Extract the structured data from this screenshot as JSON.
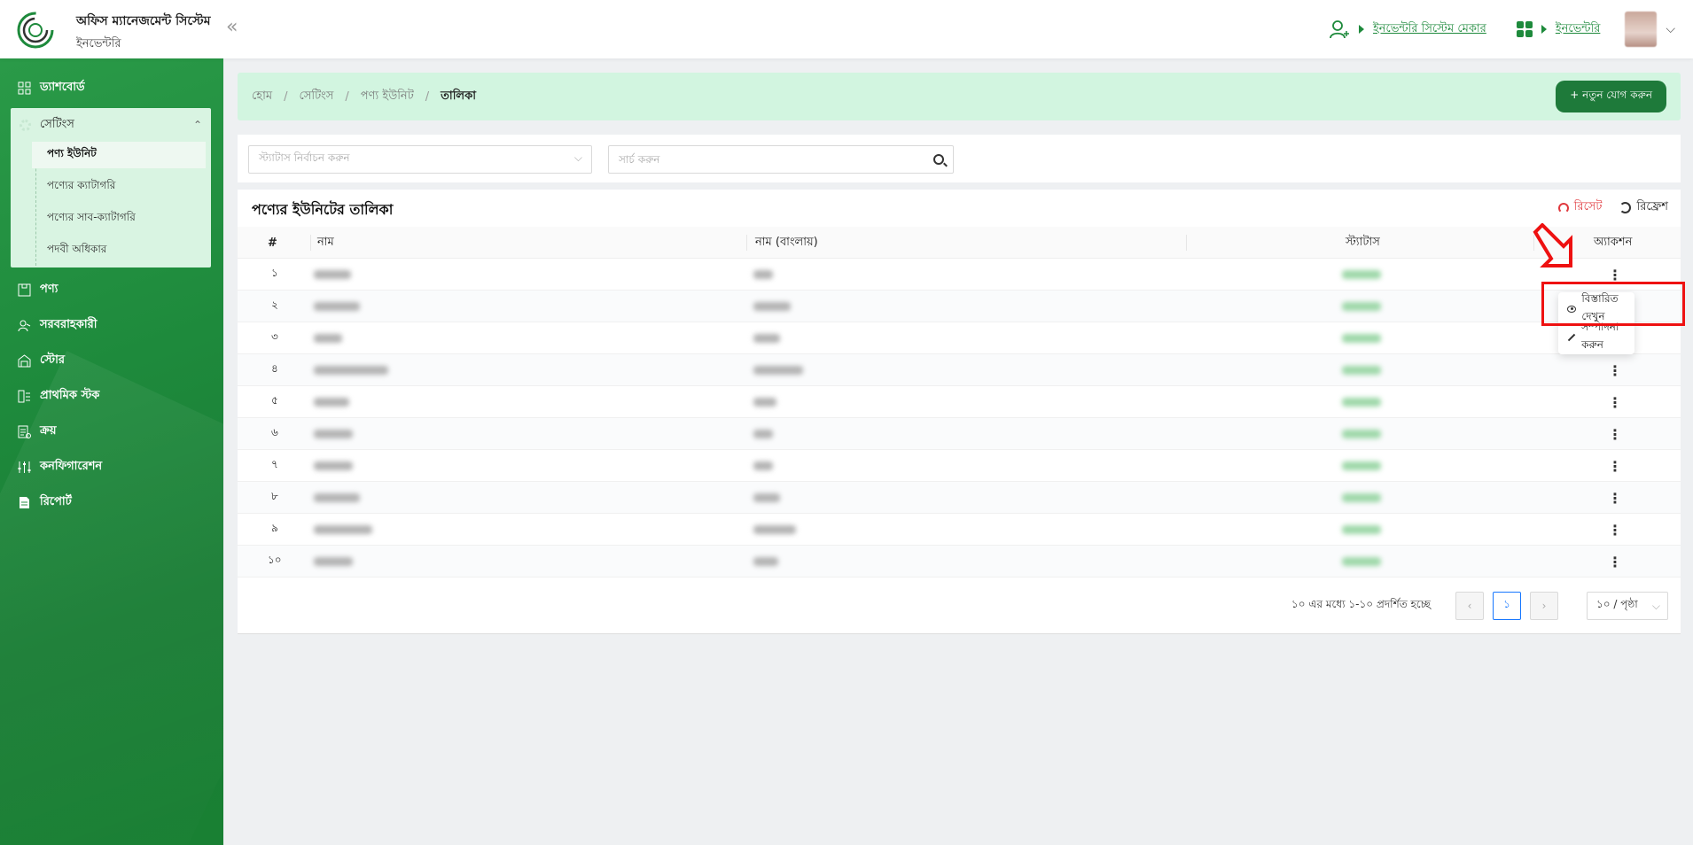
{
  "header": {
    "app_title": "অফিস ম্যানেজমেন্ট সিস্টেম",
    "app_subtitle": "ইনভেন্টরি",
    "collapse_label": "«",
    "user_link": "ইনভেন্টরি সিস্টেম মেকার",
    "module_link": "ইনভেন্টরি",
    "icons": [
      "logo",
      "user-switch-icon",
      "apps-grid-icon",
      "avatar",
      "chevron-down-icon"
    ]
  },
  "sidebar": {
    "items": [
      {
        "label": "ড্যাশবোর্ড",
        "icon": "dashboard-icon"
      },
      {
        "label": "পণ্য",
        "icon": "product-icon"
      },
      {
        "label": "সরবরাহকারী",
        "icon": "supplier-icon"
      },
      {
        "label": "স্টোর",
        "icon": "store-icon"
      },
      {
        "label": "প্রাথমিক স্টক",
        "icon": "stock-icon"
      },
      {
        "label": "ক্রয়",
        "icon": "purchase-icon"
      },
      {
        "label": "কনফিগারেশন",
        "icon": "config-icon"
      },
      {
        "label": "রিপোর্ট",
        "icon": "report-icon"
      }
    ],
    "settings": {
      "label": "সেটিংস",
      "sub_items": [
        "পণ্য ইউনিট",
        "পণ্যের ক্যাটাগরি",
        "পণ্যের সাব-ক্যাটাগরি",
        "পদবী অধিকার"
      ],
      "active_index": 0
    },
    "accent": "#1e8a3c"
  },
  "breadcrumb": [
    "হোম",
    "সেটিংস",
    "পণ্য ইউনিট",
    "তালিকা"
  ],
  "add_button": "+ নতুন যোগ করুন",
  "filters": {
    "status_placeholder": "স্ট্যাটাস নির্বাচন করুন",
    "search_placeholder": "সার্চ করুন"
  },
  "table": {
    "title": "পণ্যের ইউনিটের তালিকা",
    "reset_label": "রিসেট",
    "refresh_label": "রিফ্রেশ",
    "columns": [
      "#",
      "নাম",
      "নাম (বাংলায়)",
      "স্ট্যাটাস",
      "অ্যাকশন"
    ],
    "rows": [
      "১",
      "২",
      "৩",
      "৪",
      "৫",
      "৬",
      "৭",
      "৮",
      "৯",
      "১০"
    ]
  },
  "action_menu": {
    "view": "বিস্তারিত দেখুন",
    "edit": "সম্পাদনা করুন"
  },
  "pagination": {
    "summary": "১০ এর মধ্যে ১-১০ প্রদর্শিত হচ্ছে",
    "current_page": "১",
    "page_size": "১০ / পৃষ্ঠা"
  }
}
